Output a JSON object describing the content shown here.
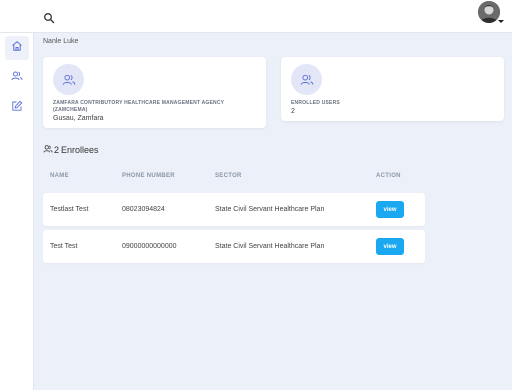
{
  "header": {
    "search_icon": "search-icon",
    "avatar_icon": "avatar-photo"
  },
  "sidebar": {
    "items": [
      {
        "icon": "home-icon",
        "active": true
      },
      {
        "icon": "users-icon",
        "active": false
      },
      {
        "icon": "edit-icon",
        "active": false
      }
    ]
  },
  "page": {
    "user_name": "Nanle Luke"
  },
  "cards": {
    "agency": {
      "icon": "users-icon",
      "name": "ZAMFARA CONTRIBUTORY HEALTHCARE MANAGEMENT AGENCY (ZAMCHEMA)",
      "location": "Gusau, Zamfara"
    },
    "enrolled": {
      "icon": "users-icon",
      "label": "ENROLLED USERS",
      "value": "2"
    }
  },
  "enrollees": {
    "count": "2",
    "label": "Enrollees",
    "columns": {
      "name": "NAME",
      "phone": "PHONE NUMBER",
      "sector": "SECTOR",
      "action": "ACTION"
    },
    "rows": [
      {
        "name": "Testlast Test",
        "phone": "08023094824",
        "sector": "State Civil Servant Healthcare Plan",
        "action": "view"
      },
      {
        "name": "Test Test",
        "phone": "09000000000000",
        "sector": "State Civil Servant Healthcare Plan",
        "action": "view"
      }
    ]
  },
  "colors": {
    "accent": "#1aa8f0",
    "icon_tint": "#5b6fd6",
    "background": "#ecf0f8"
  }
}
